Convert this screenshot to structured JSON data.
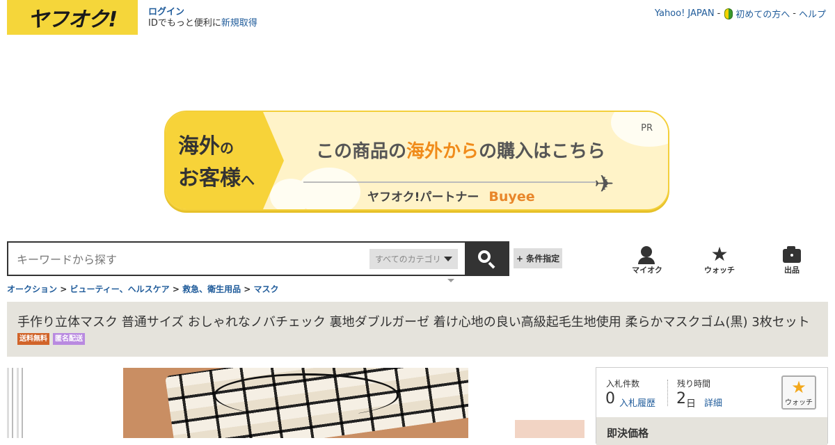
{
  "header": {
    "logo_text": "ヤフオク!",
    "login_label": "ログイン",
    "login_sub_prefix": "IDでもっと便利に",
    "register_label": "新規取得",
    "top_links": [
      "Yahoo! JAPAN",
      "初めての方へ",
      "ヘルプ"
    ],
    "separator": "-",
    "brand_color": "#f5d63a"
  },
  "banner": {
    "left_line1_big": "海外",
    "left_line1_small": "の",
    "left_line2_big": "お客様",
    "left_line2_small": "へ",
    "main_pre": "この商品の",
    "main_highlight": "海外から",
    "main_post": "の購入はこちら",
    "pr": "PR",
    "partner": "ヤフオク!パートナー",
    "buyee": "Buyee",
    "plane_icon": "✈"
  },
  "search": {
    "placeholder": "キーワードから探す",
    "category": "すべてのカテゴリ",
    "conditions_label": "+ 条件指定"
  },
  "nav_icons": [
    {
      "name": "myauc",
      "label": "マイオク"
    },
    {
      "name": "watch",
      "label": "ウォッチ"
    },
    {
      "name": "sell",
      "label": "出品"
    }
  ],
  "breadcrumb": {
    "items": [
      "オークション",
      "ビューティー、ヘルスケア",
      "救急、衛生用品",
      "マスク"
    ],
    "sep": ">"
  },
  "item": {
    "title": "手作り立体マスク 普通サイズ おしゃれなノバチェック 裏地ダブルガーゼ 着け心地の良い高級起毛生地使用 柔らかマスクゴム(黒) 3枚セット",
    "tags": [
      "送料無料",
      "匿名配送"
    ]
  },
  "info": {
    "bids_label": "入札件数",
    "bids_value": "0",
    "bid_history_link": "入札履歴",
    "time_label": "残り時間",
    "time_value": "2",
    "time_unit": "日",
    "detail_link": "詳細",
    "watch_label": "ウォッチ",
    "buynow_label": "即決価格"
  }
}
